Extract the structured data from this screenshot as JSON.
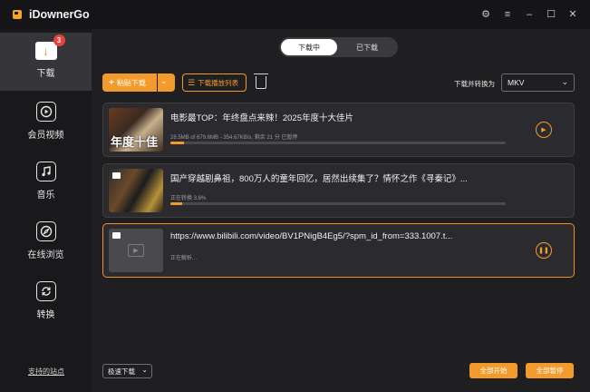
{
  "app": {
    "title": "iDownerGo"
  },
  "window_controls": {
    "settings": "⚙",
    "menu": "≡",
    "minimize": "–",
    "maximize": "☐",
    "close": "✕"
  },
  "sidebar": {
    "items": [
      {
        "label": "下载",
        "icon": "download-icon",
        "badge": "3"
      },
      {
        "label": "会员视频",
        "icon": "play-circle-icon"
      },
      {
        "label": "音乐",
        "icon": "music-note-icon"
      },
      {
        "label": "在线浏览",
        "icon": "compass-icon"
      },
      {
        "label": "转换",
        "icon": "convert-icon"
      }
    ],
    "support_link": "支持的站点"
  },
  "tabs": {
    "downloading": "下载中",
    "finished": "已下载"
  },
  "toolbar": {
    "paste_label": "粘贴下载",
    "playlist_label": "下载播放列表",
    "convert_label": "下载并转换为",
    "format": "MKV"
  },
  "downloads": [
    {
      "title": "电影最TOP：年终盘点来辣！2025年度十大佳片",
      "thumb_text": "年度十佳",
      "status": "28.5MB of 679.6MB - 354.67KB/s, 剩余 21 分 已暂停",
      "progress": 0.04,
      "action": "play"
    },
    {
      "title": "国产穿越剧鼻祖，800万人的童年回忆，居然出续集了？情怀之作《寻秦记》...",
      "status": "正在转换 3.6%",
      "progress": 0.036,
      "action": "none"
    },
    {
      "title": "https://www.bilibili.com/video/BV1PNigB4Eg5/?spm_id_from=333.1007.t...",
      "status": "正在解析...",
      "progress": null,
      "action": "pause"
    }
  ],
  "bottom": {
    "speed_mode": "极速下载",
    "start_all": "全部开始",
    "pause_all": "全部暂停"
  },
  "colors": {
    "accent": "#f39a2c",
    "background": "#1f1f22",
    "sidebar": "#19191c",
    "card": "#2b2b2f"
  }
}
